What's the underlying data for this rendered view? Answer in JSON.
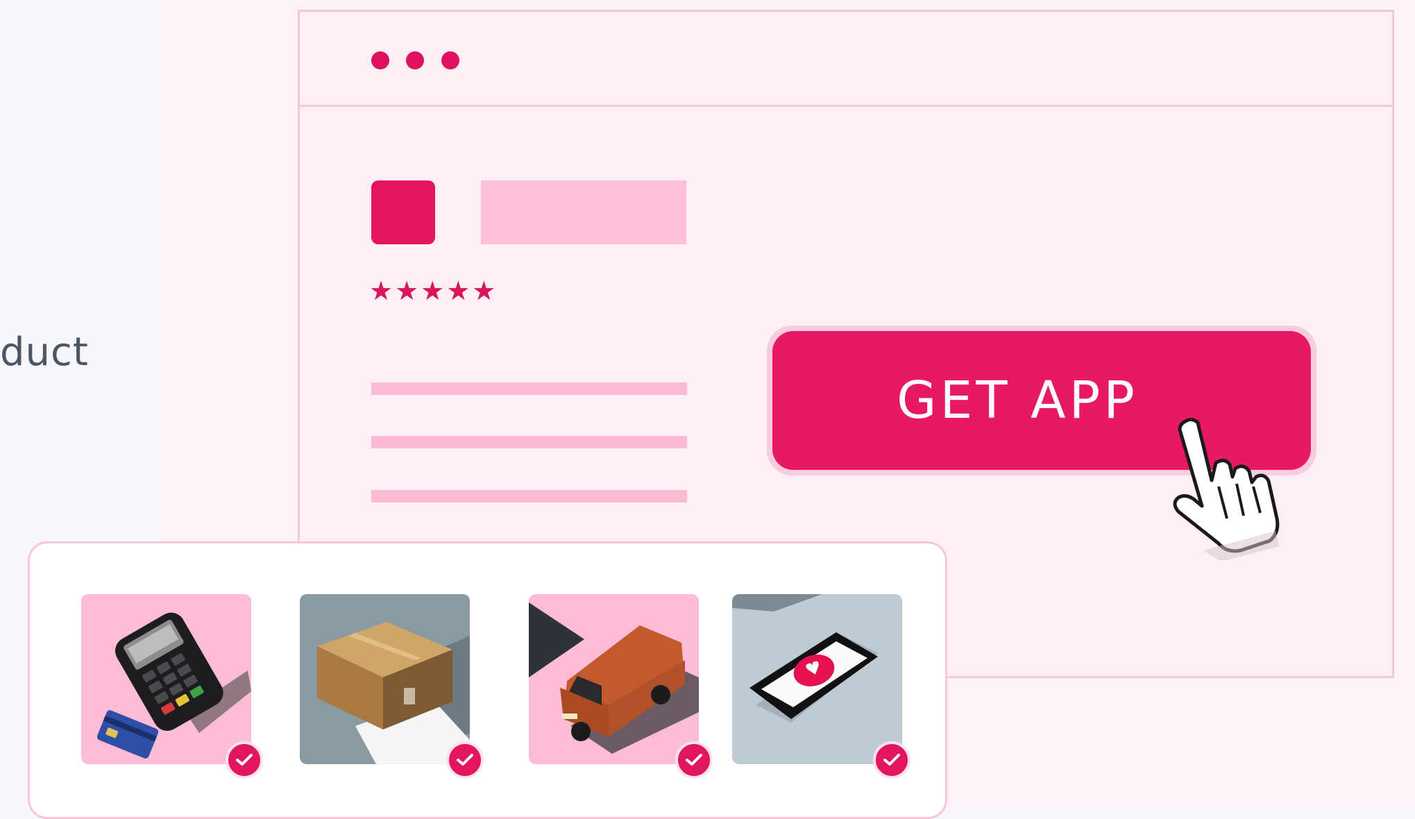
{
  "left_panel": {
    "partial_text": "duct"
  },
  "window": {
    "rating_stars": "★★★★★",
    "cta": {
      "label": "GET APP"
    }
  },
  "products": [
    {
      "name": "card-terminal",
      "icon": "pos-terminal-icon",
      "selected": true
    },
    {
      "name": "shipping-box",
      "icon": "package-box-icon",
      "selected": true
    },
    {
      "name": "delivery-van",
      "icon": "delivery-van-icon",
      "selected": true
    },
    {
      "name": "phone-heart",
      "icon": "smartphone-heart-icon",
      "selected": true
    }
  ],
  "colors": {
    "accent": "#e81862",
    "accent_light": "#fdbfda",
    "window_bg": "#fdf0f5",
    "border": "#f7c6d8"
  }
}
